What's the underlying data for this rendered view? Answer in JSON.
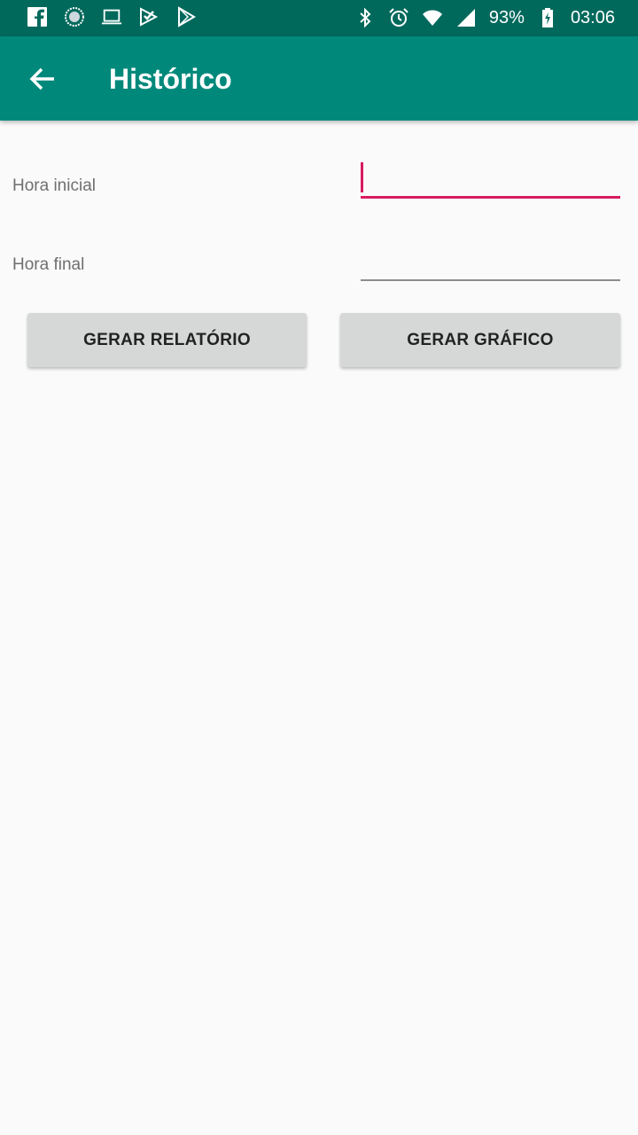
{
  "status_bar": {
    "battery": "93%",
    "time": "03:06",
    "left_icons": [
      "facebook-icon",
      "globe-icon",
      "laptop-icon",
      "tasks-icon",
      "play-store-icon"
    ],
    "right_icons": [
      "bluetooth-icon",
      "alarm-icon",
      "wifi-icon",
      "signal-icon",
      "battery-icon"
    ]
  },
  "appbar": {
    "title": "Histórico",
    "back_icon": "arrow-back-icon",
    "color": "#00897b"
  },
  "form": {
    "start_label": "Hora inicial",
    "start_value": "",
    "end_label": "Hora final",
    "end_value": ""
  },
  "buttons": {
    "report": "GERAR RELATÓRIO",
    "chart": "GERAR GRÁFICO"
  },
  "colors": {
    "status_bar": "#00695c",
    "accent": "#d81b60",
    "background": "#fafafa"
  }
}
